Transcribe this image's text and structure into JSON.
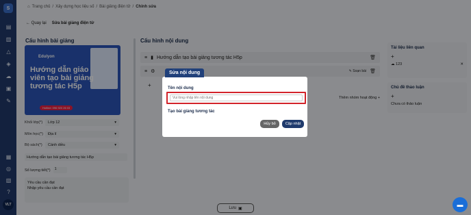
{
  "sidebar": {
    "avatar": "VLT",
    "logo": "S",
    "icons": [
      "home-icon",
      "document-icon",
      "book-icon",
      "list-icon",
      "chart-icon",
      "education-icon",
      "cloud-icon",
      "gallery-icon",
      "folder-icon",
      "tools-icon",
      "stats-icon",
      "globe-icon",
      "building-icon",
      "help-icon"
    ]
  },
  "breadcrumb": {
    "home_icon": "⌂",
    "items": [
      "Trang chủ",
      "Xây dựng học liệu số",
      "Bài giảng điện tử",
      "Chỉnh sửa"
    ],
    "separator": "/"
  },
  "back": {
    "label": "Quay lại",
    "title": "Sửa bài giảng điện tử"
  },
  "left": {
    "title": "Cấu hình bài giảng",
    "thumbnail": {
      "heading": "Hướng dẫn giáo viên tạo bài giảng tương tác H5p",
      "hotline": "Hotline: 096 920 26 03",
      "brand": "Edulyon"
    },
    "fields": [
      {
        "label": "Khối lớp(*)",
        "value": "Lớp 12"
      },
      {
        "label": "Môn học(*)",
        "value": "Địa lí"
      },
      {
        "label": "Bộ sách(*)",
        "value": "Cánh diều"
      }
    ],
    "lesson_name": "Hướng dẫn tạo bài giảng tương tác H5p",
    "lesson_count_label": "Số lượng tiết(*)",
    "lesson_count_value": "1",
    "req_label": "Yêu cầu cần đạt",
    "req_placeholder": "Nhập yêu cầu cần đạt"
  },
  "middle": {
    "title": "Cấu hình nội dung",
    "row1": "Hướng dẫn tạo bài giảng tương tác H5p",
    "row2_edit": "Soạn bài",
    "add": "+",
    "add_group": "Thêm nhóm hoạt động +"
  },
  "right": {
    "docs_title": "Tài liệu liên quan",
    "doc_item": "123",
    "topics_title": "Chủ đề thảo luận",
    "no_topics": "Chưa có thảo luận"
  },
  "save_label": "Lưu",
  "modal": {
    "tab": "Sửa nội dung",
    "label_name": "Tên nội dung",
    "placeholder": "Vui lòng nhập tên nội dung",
    "label_type": "Tạo bài giảng tương tác",
    "cancel": "Hủy bỏ",
    "update": "Cập nhật"
  },
  "colors": {
    "sidebar": "#213a6b",
    "primary": "#203b6d",
    "highlight_border": "#d2232a",
    "chat": "#1a6ed8"
  }
}
